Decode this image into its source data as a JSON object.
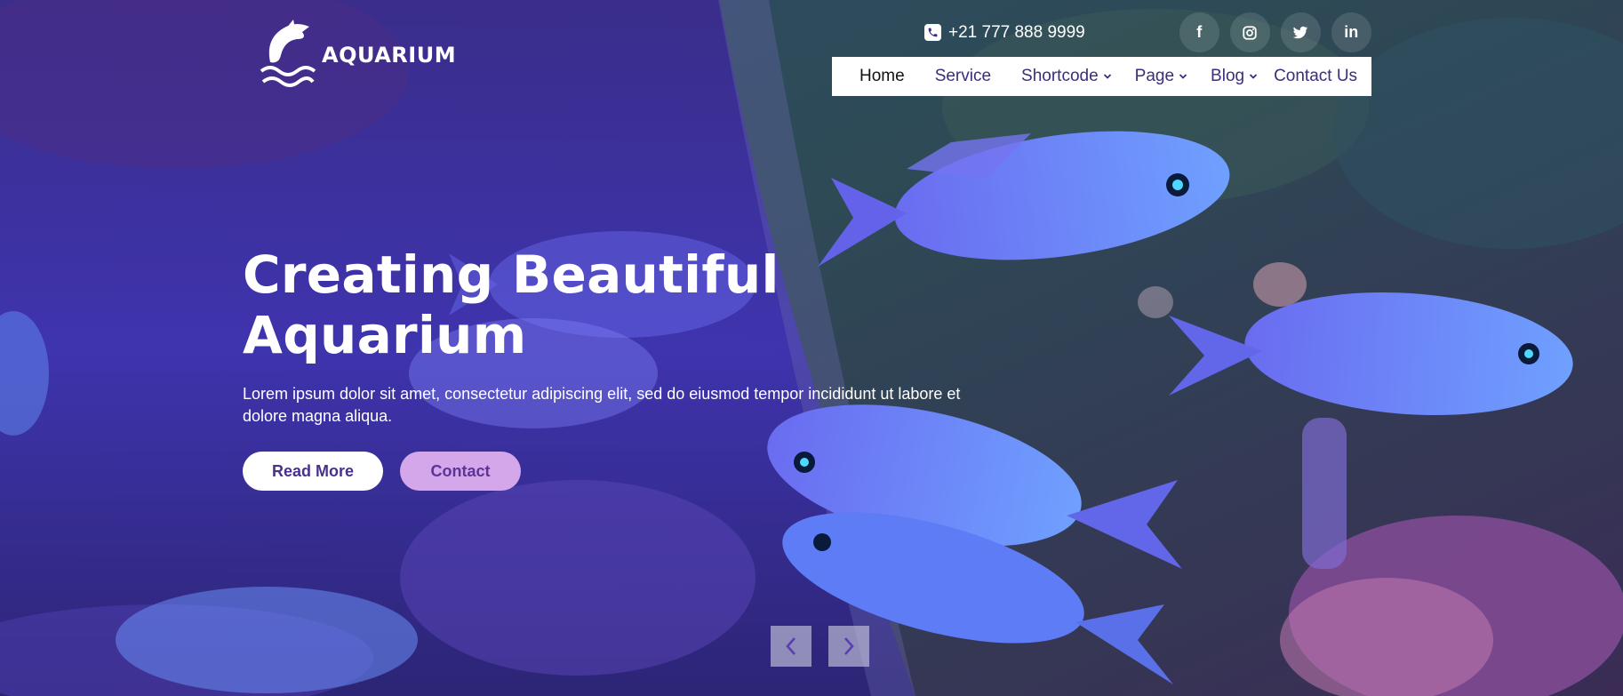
{
  "brand": {
    "name": "AQUARIUM",
    "logo_icon": "dolphin-icon"
  },
  "contact": {
    "phone": "+21 777 888 9999",
    "phone_icon": "phone-icon"
  },
  "socials": [
    {
      "name": "facebook",
      "glyph": "f"
    },
    {
      "name": "instagram",
      "glyph": ""
    },
    {
      "name": "twitter",
      "glyph": ""
    },
    {
      "name": "linkedin",
      "glyph": "in"
    }
  ],
  "nav": {
    "items": [
      {
        "label": "Home",
        "active": true,
        "dropdown": false
      },
      {
        "label": "Service",
        "active": false,
        "dropdown": false
      },
      {
        "label": "Shortcode",
        "active": false,
        "dropdown": true
      },
      {
        "label": "Page",
        "active": false,
        "dropdown": true
      },
      {
        "label": "Blog",
        "active": false,
        "dropdown": true
      },
      {
        "label": "Contact Us",
        "active": false,
        "dropdown": false
      }
    ]
  },
  "hero": {
    "headline_line1": "Creating Beautiful",
    "headline_line2": "Aquarium",
    "subtext": "Lorem ipsum dolor sit amet, consectetur adipiscing elit, sed do eiusmod tempor incididunt ut labore et dolore magna aliqua.",
    "read_more_label": "Read More",
    "contact_label": "Contact"
  },
  "slider": {
    "prev_icon": "chevron-left-icon",
    "next_icon": "chevron-right-icon"
  },
  "colors": {
    "overlay": "#4a2fd6",
    "accent": "#d4a6ea",
    "nav_text": "#3b2e7a",
    "fish": "#5a7cff"
  }
}
